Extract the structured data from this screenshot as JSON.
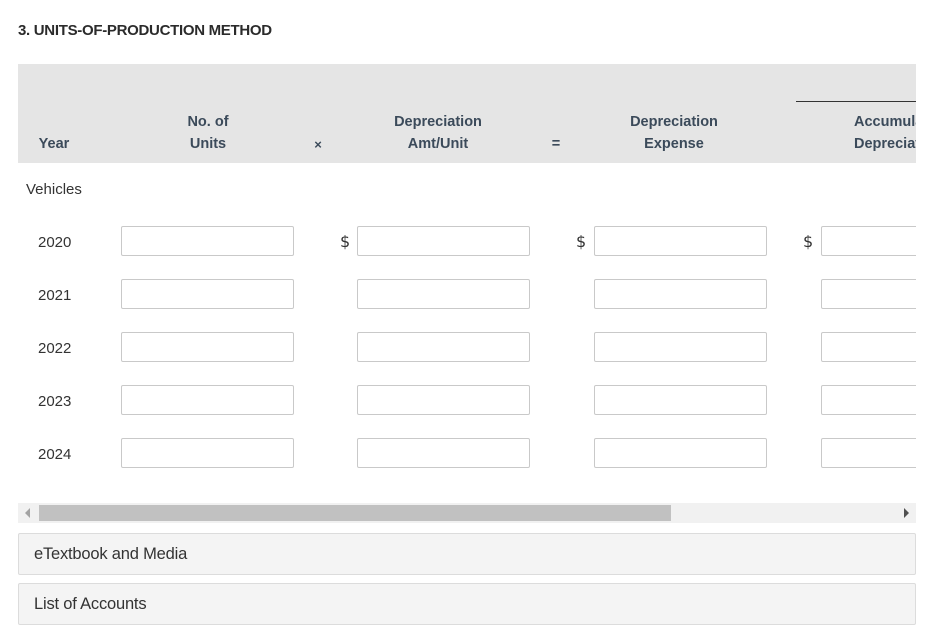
{
  "section_title": "3. UNITS-OF-PRODUCTION METHOD",
  "table": {
    "headers": {
      "year": "Year",
      "units_line1": "No. of",
      "units_line2": "Units",
      "times": "×",
      "rate_line1": "Depreciation",
      "rate_line2": "Amt/Unit",
      "equals": "=",
      "expense_line1": "Depreciation",
      "expense_line2": "Expense",
      "accum_line1": "Accumulated",
      "accum_line2": "Depreciation"
    },
    "group_label": "Vehicles",
    "currency_symbol": "$",
    "rows": [
      {
        "year": "2020",
        "units": "",
        "rate": "",
        "expense": "",
        "accum": ""
      },
      {
        "year": "2021",
        "units": "",
        "rate": "",
        "expense": "",
        "accum": ""
      },
      {
        "year": "2022",
        "units": "",
        "rate": "",
        "expense": "",
        "accum": ""
      },
      {
        "year": "2023",
        "units": "",
        "rate": "",
        "expense": "",
        "accum": ""
      },
      {
        "year": "2024",
        "units": "",
        "rate": "",
        "expense": "",
        "accum": ""
      }
    ]
  },
  "scrollbar": {
    "thumb_fraction": 0.7,
    "position_fraction": 0.0
  },
  "panels": {
    "etextbook": "eTextbook and Media",
    "accounts": "List of Accounts"
  }
}
